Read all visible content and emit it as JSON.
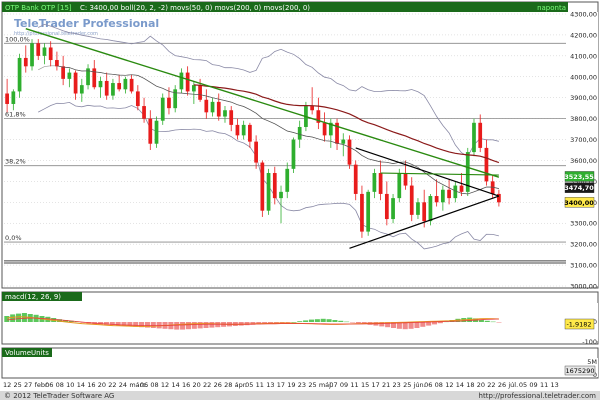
{
  "header": {
    "instrument": "OTP Bank OTP [15]",
    "indicators": "C: 3400,00 boll(20, 2, -2) movs(50, 0) movs(200, 0) movs(200, 0)",
    "period": "naponta"
  },
  "watermark": {
    "brand": "TeleTrader Professional",
    "url": "http://professional.teletrader.com"
  },
  "footer": {
    "copyright": "© 2012 TeleTrader Software AG",
    "url": "http://professional.teletrader.com"
  },
  "colors": {
    "up_candle": "#2eae2e",
    "down_candle": "#e81c1c",
    "bollinger": "#8a8aa6",
    "ma50": "#1a1a1a",
    "ma200": "#8b1a1a",
    "trendline": "#2a8a10",
    "triangle": "#000000",
    "grid": "#c8c8c8",
    "header_bg": "#1a6a1a",
    "header_text": "#7cff7c"
  },
  "chart_data": [
    {
      "type": "candlestick",
      "title": "OTP Bank OTP [15]",
      "ylim": [
        3000,
        4300
      ],
      "y_ticks": [
        "4300,00",
        "4200,00",
        "4100,00",
        "4000,00",
        "3900,00",
        "3800,00",
        "3700,00",
        "3600,00",
        "3500,00",
        "3400,00",
        "3300,00",
        "3200,00",
        "3100,00",
        "3000,00"
      ],
      "fib_levels": [
        {
          "label": "100,0%",
          "value": 4160
        },
        {
          "label": "61,8%",
          "value": 3800
        },
        {
          "label": "38,2%",
          "value": 3575
        },
        {
          "label": "0,0%",
          "value": 3210
        }
      ],
      "price_tags": [
        {
          "label": "3523,55",
          "value": 3523.55,
          "color": "#2eae2e"
        },
        {
          "label": "3474,70",
          "value": 3474.7,
          "color": "#1a1a1a"
        },
        {
          "label": "3400,00",
          "value": 3400,
          "color": "#ffe94a"
        }
      ],
      "extra_levels": [
        3120,
        3110
      ],
      "candles": [
        {
          "o": 3920,
          "h": 3990,
          "l": 3830,
          "c": 3870
        },
        {
          "o": 3870,
          "h": 3940,
          "l": 3840,
          "c": 3930
        },
        {
          "o": 3930,
          "h": 4110,
          "l": 3900,
          "c": 4090
        },
        {
          "o": 4090,
          "h": 4150,
          "l": 4020,
          "c": 4050
        },
        {
          "o": 4050,
          "h": 4180,
          "l": 4030,
          "c": 4160
        },
        {
          "o": 4160,
          "h": 4180,
          "l": 4080,
          "c": 4100
        },
        {
          "o": 4100,
          "h": 4160,
          "l": 4060,
          "c": 4140
        },
        {
          "o": 4140,
          "h": 4170,
          "l": 4050,
          "c": 4080
        },
        {
          "o": 4080,
          "h": 4120,
          "l": 4030,
          "c": 4050
        },
        {
          "o": 4050,
          "h": 4100,
          "l": 3960,
          "c": 3990
        },
        {
          "o": 3990,
          "h": 4040,
          "l": 3950,
          "c": 4020
        },
        {
          "o": 4020,
          "h": 4030,
          "l": 3890,
          "c": 3920
        },
        {
          "o": 3920,
          "h": 3990,
          "l": 3880,
          "c": 3960
        },
        {
          "o": 3960,
          "h": 4060,
          "l": 3940,
          "c": 4040
        },
        {
          "o": 4040,
          "h": 4080,
          "l": 3940,
          "c": 3950
        },
        {
          "o": 3950,
          "h": 4000,
          "l": 3900,
          "c": 3980
        },
        {
          "o": 3980,
          "h": 4020,
          "l": 3890,
          "c": 3910
        },
        {
          "o": 3910,
          "h": 3990,
          "l": 3890,
          "c": 3970
        },
        {
          "o": 3970,
          "h": 4010,
          "l": 3930,
          "c": 3940
        },
        {
          "o": 3940,
          "h": 4000,
          "l": 3920,
          "c": 3990
        },
        {
          "o": 3990,
          "h": 4010,
          "l": 3920,
          "c": 3930
        },
        {
          "o": 3930,
          "h": 3960,
          "l": 3840,
          "c": 3860
        },
        {
          "o": 3860,
          "h": 3900,
          "l": 3780,
          "c": 3800
        },
        {
          "o": 3800,
          "h": 3840,
          "l": 3650,
          "c": 3680
        },
        {
          "o": 3680,
          "h": 3810,
          "l": 3660,
          "c": 3790
        },
        {
          "o": 3790,
          "h": 3920,
          "l": 3770,
          "c": 3900
        },
        {
          "o": 3900,
          "h": 3950,
          "l": 3820,
          "c": 3850
        },
        {
          "o": 3850,
          "h": 3960,
          "l": 3830,
          "c": 3940
        },
        {
          "o": 3940,
          "h": 4040,
          "l": 3920,
          "c": 4020
        },
        {
          "o": 4020,
          "h": 4050,
          "l": 3910,
          "c": 3930
        },
        {
          "o": 3930,
          "h": 3980,
          "l": 3870,
          "c": 3960
        },
        {
          "o": 3960,
          "h": 3990,
          "l": 3880,
          "c": 3890
        },
        {
          "o": 3890,
          "h": 3940,
          "l": 3800,
          "c": 3830
        },
        {
          "o": 3830,
          "h": 3900,
          "l": 3810,
          "c": 3880
        },
        {
          "o": 3880,
          "h": 3920,
          "l": 3790,
          "c": 3810
        },
        {
          "o": 3810,
          "h": 3860,
          "l": 3780,
          "c": 3840
        },
        {
          "o": 3840,
          "h": 3860,
          "l": 3740,
          "c": 3770
        },
        {
          "o": 3770,
          "h": 3800,
          "l": 3700,
          "c": 3720
        },
        {
          "o": 3720,
          "h": 3790,
          "l": 3700,
          "c": 3770
        },
        {
          "o": 3770,
          "h": 3780,
          "l": 3660,
          "c": 3690
        },
        {
          "o": 3690,
          "h": 3720,
          "l": 3560,
          "c": 3590
        },
        {
          "o": 3590,
          "h": 3600,
          "l": 3330,
          "c": 3360
        },
        {
          "o": 3360,
          "h": 3560,
          "l": 3340,
          "c": 3540
        },
        {
          "o": 3540,
          "h": 3570,
          "l": 3390,
          "c": 3420
        },
        {
          "o": 3420,
          "h": 3480,
          "l": 3300,
          "c": 3450
        },
        {
          "o": 3450,
          "h": 3590,
          "l": 3420,
          "c": 3560
        },
        {
          "o": 3560,
          "h": 3710,
          "l": 3540,
          "c": 3700
        },
        {
          "o": 3700,
          "h": 3790,
          "l": 3660,
          "c": 3760
        },
        {
          "o": 3760,
          "h": 3880,
          "l": 3740,
          "c": 3860
        },
        {
          "o": 3860,
          "h": 3950,
          "l": 3820,
          "c": 3840
        },
        {
          "o": 3840,
          "h": 3900,
          "l": 3750,
          "c": 3780
        },
        {
          "o": 3780,
          "h": 3830,
          "l": 3690,
          "c": 3720
        },
        {
          "o": 3720,
          "h": 3800,
          "l": 3660,
          "c": 3780
        },
        {
          "o": 3780,
          "h": 3800,
          "l": 3650,
          "c": 3680
        },
        {
          "o": 3680,
          "h": 3730,
          "l": 3620,
          "c": 3700
        },
        {
          "o": 3700,
          "h": 3720,
          "l": 3560,
          "c": 3580
        },
        {
          "o": 3580,
          "h": 3600,
          "l": 3410,
          "c": 3440
        },
        {
          "o": 3440,
          "h": 3480,
          "l": 3230,
          "c": 3260
        },
        {
          "o": 3260,
          "h": 3460,
          "l": 3240,
          "c": 3450
        },
        {
          "o": 3450,
          "h": 3560,
          "l": 3420,
          "c": 3540
        },
        {
          "o": 3540,
          "h": 3600,
          "l": 3410,
          "c": 3440
        },
        {
          "o": 3440,
          "h": 3500,
          "l": 3290,
          "c": 3320
        },
        {
          "o": 3320,
          "h": 3440,
          "l": 3300,
          "c": 3420
        },
        {
          "o": 3420,
          "h": 3560,
          "l": 3400,
          "c": 3540
        },
        {
          "o": 3540,
          "h": 3600,
          "l": 3460,
          "c": 3480
        },
        {
          "o": 3480,
          "h": 3520,
          "l": 3310,
          "c": 3340
        },
        {
          "o": 3340,
          "h": 3420,
          "l": 3320,
          "c": 3400
        },
        {
          "o": 3400,
          "h": 3460,
          "l": 3280,
          "c": 3310
        },
        {
          "o": 3310,
          "h": 3440,
          "l": 3290,
          "c": 3430
        },
        {
          "o": 3430,
          "h": 3510,
          "l": 3380,
          "c": 3400
        },
        {
          "o": 3400,
          "h": 3480,
          "l": 3360,
          "c": 3460
        },
        {
          "o": 3460,
          "h": 3510,
          "l": 3390,
          "c": 3420
        },
        {
          "o": 3420,
          "h": 3500,
          "l": 3400,
          "c": 3480
        },
        {
          "o": 3480,
          "h": 3540,
          "l": 3430,
          "c": 3450
        },
        {
          "o": 3450,
          "h": 3660,
          "l": 3430,
          "c": 3640
        },
        {
          "o": 3640,
          "h": 3800,
          "l": 3620,
          "c": 3780
        },
        {
          "o": 3780,
          "h": 3820,
          "l": 3640,
          "c": 3660
        },
        {
          "o": 3660,
          "h": 3700,
          "l": 3480,
          "c": 3500
        },
        {
          "o": 3500,
          "h": 3530,
          "l": 3420,
          "c": 3440
        },
        {
          "o": 3440,
          "h": 3460,
          "l": 3380,
          "c": 3400
        }
      ]
    },
    {
      "type": "histogram",
      "title": "macd(12, 26, 9)",
      "value_tag": "-1,9182",
      "ylim": [
        -100,
        100
      ],
      "y_ticks": [
        "0",
        "-100"
      ],
      "histogram": [
        30,
        38,
        42,
        45,
        40,
        36,
        30,
        26,
        20,
        14,
        10,
        6,
        2,
        -4,
        -8,
        -10,
        -12,
        -14,
        -16,
        -18,
        -20,
        -22,
        -24,
        -26,
        -28,
        -30,
        -32,
        -34,
        -36,
        -38,
        -38,
        -36,
        -34,
        -32,
        -30,
        -28,
        -26,
        -24,
        -22,
        -20,
        -18,
        -16,
        -14,
        -12,
        -10,
        -8,
        -6,
        -4,
        -2,
        0,
        4,
        8,
        12,
        14,
        16,
        14,
        10,
        6,
        2,
        -2,
        -6,
        -10,
        -14,
        -18,
        -22,
        -26,
        -30,
        -34,
        -36,
        -34,
        -30,
        -24,
        -18,
        -12,
        -6,
        2,
        10,
        16,
        20,
        22,
        18,
        12,
        6,
        2,
        -2
      ],
      "macd_line": [
        20,
        24,
        26,
        25,
        22,
        18,
        14,
        10,
        6,
        2,
        -2,
        -5,
        -8,
        -10,
        -12,
        -14,
        -16,
        -18,
        -19,
        -20,
        -21,
        -22,
        -22,
        -21,
        -20,
        -18,
        -16,
        -14,
        -12,
        -10,
        -9,
        -8,
        -8,
        -9,
        -10,
        -11,
        -12,
        -12,
        -11,
        -10,
        -9,
        -8,
        -7,
        -6,
        -5,
        -5,
        -6,
        -7,
        -8,
        -9,
        -10,
        -11,
        -12,
        -12,
        -11,
        -10,
        -9,
        -8,
        -7,
        -6,
        -5,
        -4,
        -3,
        -2,
        -1,
        0,
        1,
        2,
        3,
        4,
        5,
        6,
        8,
        10,
        12,
        14,
        16,
        17,
        16,
        15
      ],
      "signal_line": [
        10,
        14,
        17,
        19,
        20,
        19,
        17,
        15,
        12,
        9,
        6,
        3,
        0,
        -3,
        -6,
        -8,
        -10,
        -12,
        -14,
        -15,
        -16,
        -17,
        -18,
        -18,
        -18,
        -18,
        -17,
        -16,
        -15,
        -14,
        -13,
        -12,
        -11,
        -11,
        -11,
        -11,
        -11,
        -11,
        -11,
        -11,
        -10,
        -10,
        -9,
        -9,
        -8,
        -8,
        -8,
        -8,
        -8,
        -8,
        -9,
        -9,
        -10,
        -10,
        -10,
        -10,
        -10,
        -10,
        -9,
        -9,
        -8,
        -7,
        -6,
        -5,
        -4,
        -3,
        -2,
        -1,
        0,
        1,
        2,
        3,
        4,
        5,
        7,
        9,
        11,
        13,
        14,
        15
      ]
    },
    {
      "type": "bar",
      "title": "VolumeUnits",
      "value_tag": "1675290",
      "y_ticks": [
        "5M",
        "0"
      ]
    }
  ],
  "x_axis": {
    "labels": [
      "12",
      "25",
      "27",
      "febr.",
      "06",
      "08",
      "10",
      "14",
      "16",
      "20",
      "22",
      "24",
      "márc.",
      "06",
      "08",
      "12",
      "14",
      "16",
      "20",
      "22",
      "26",
      "28",
      "ápr.",
      "05",
      "11",
      "13",
      "17",
      "19",
      "23",
      "25",
      "máj.",
      "07",
      "09",
      "11",
      "15",
      "17",
      "21",
      "23",
      "25",
      "jún.",
      "06",
      "08",
      "12",
      "14",
      "18",
      "20",
      "22",
      "26",
      "júl.",
      "05",
      "09",
      "11",
      "13"
    ]
  }
}
